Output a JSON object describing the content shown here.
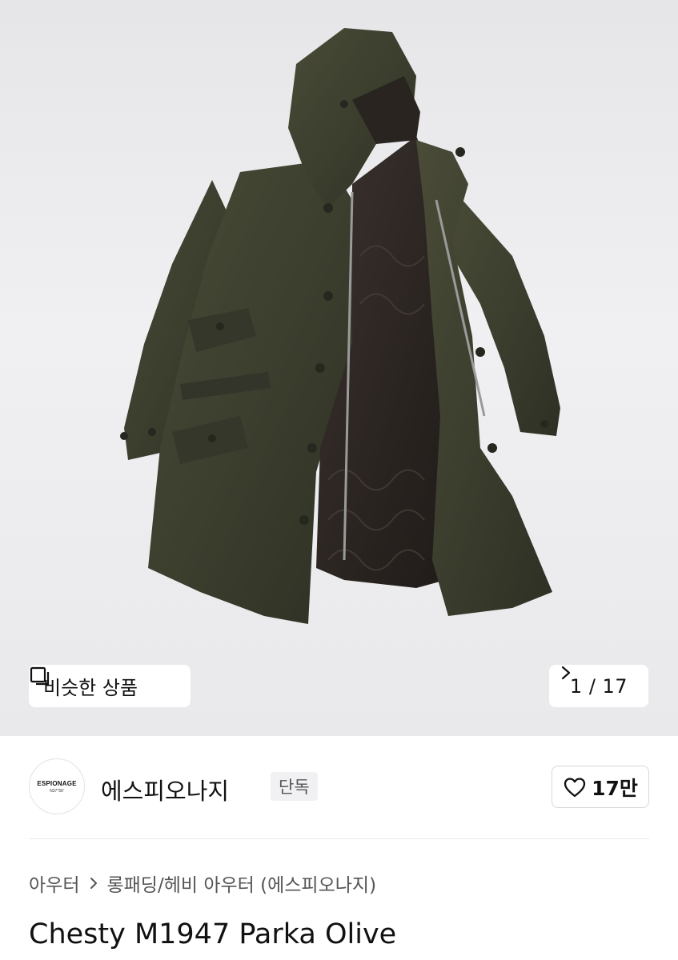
{
  "gallery": {
    "similar_label": "비슷한 상품",
    "page_indicator": "1 / 17"
  },
  "brand": {
    "logo_text": "ESPIONAGE",
    "logo_subtext": "N37°56'",
    "name": "에스피오나지",
    "badge": "단독",
    "like_count": "17만"
  },
  "breadcrumb": {
    "category": "아우터",
    "subcategory": "롱패딩/헤비 아우터 (에스피오나지)"
  },
  "product": {
    "title": "Chesty M1947 Parka Olive"
  },
  "colors": {
    "parka_olive": "#3e4030",
    "liner_brown": "#2b2522",
    "hero_bg": "#ececee"
  }
}
